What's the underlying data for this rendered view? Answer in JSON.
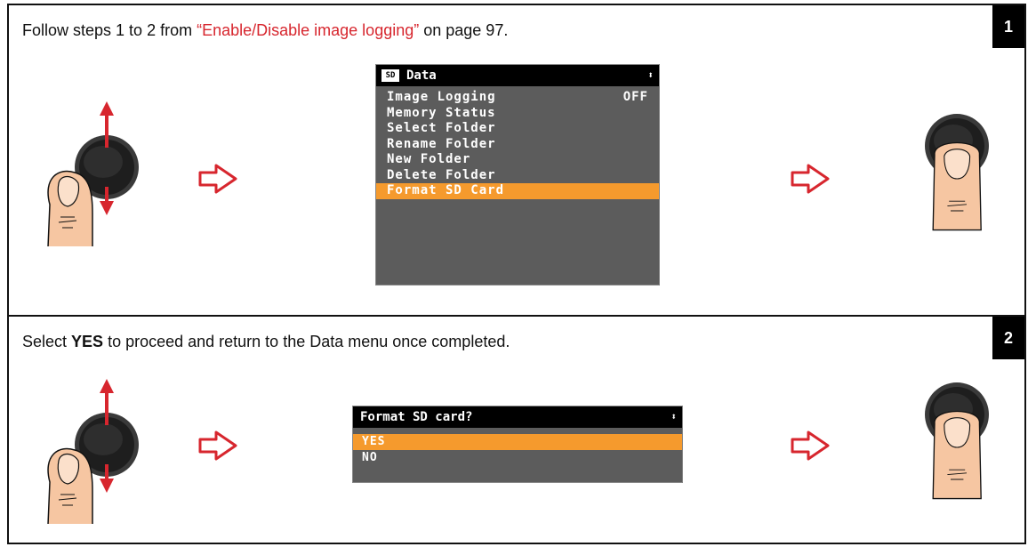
{
  "step1": {
    "number": "1",
    "instruction_prefix": "Follow steps 1 to 2 from ",
    "instruction_link": "“Enable/Disable image logging”",
    "instruction_suffix": " on page 97.",
    "screen": {
      "sd_icon": "SD",
      "title": "Data",
      "updown_icon": "⬍",
      "items": [
        {
          "label": "Image Logging",
          "value": "OFF",
          "selected": false
        },
        {
          "label": "Memory Status",
          "value": "",
          "selected": false
        },
        {
          "label": "Select Folder",
          "value": "",
          "selected": false
        },
        {
          "label": "Rename Folder",
          "value": "",
          "selected": false
        },
        {
          "label": "New Folder",
          "value": "",
          "selected": false
        },
        {
          "label": "Delete Folder",
          "value": "",
          "selected": false
        },
        {
          "label": "Format SD Card",
          "value": "",
          "selected": true
        }
      ]
    }
  },
  "step2": {
    "number": "2",
    "instruction_prefix": "Select ",
    "instruction_bold": "YES",
    "instruction_suffix": " to proceed and return to the Data menu once completed.",
    "screen": {
      "title": "Format SD card?",
      "updown_icon": "⬍",
      "items": [
        {
          "label": "YES",
          "selected": true
        },
        {
          "label": "NO",
          "selected": false
        }
      ]
    }
  },
  "icons": {
    "rotate_knob": "rotary-knob-scroll-icon",
    "press_knob": "rotary-knob-press-icon",
    "next_arrow": "next-step-arrow-icon"
  },
  "colors": {
    "link": "#d7262e",
    "arrow": "#d7262e",
    "selection": "#f59a2d",
    "screen_bg": "#5c5c5c"
  }
}
